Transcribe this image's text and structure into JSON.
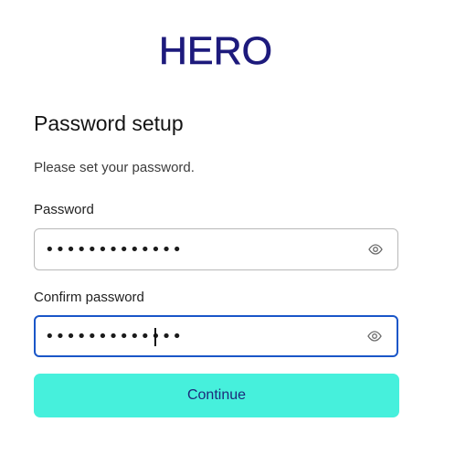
{
  "brand": {
    "logo_text": "HERO",
    "logo_color": "#1d1a7c"
  },
  "form": {
    "title": "Password setup",
    "subtitle": "Please set your password.",
    "password": {
      "label": "Password",
      "value": "•••••••••••••"
    },
    "confirm_password": {
      "label": "Confirm password",
      "value": "•••••••••••••"
    },
    "continue_label": "Continue"
  },
  "icons": {
    "password_toggle": "eye-icon",
    "confirm_toggle": "eye-icon"
  },
  "colors": {
    "accent_button": "#46f0dc",
    "button_text": "#1d2a7a",
    "focus_border": "#1a56c8"
  }
}
